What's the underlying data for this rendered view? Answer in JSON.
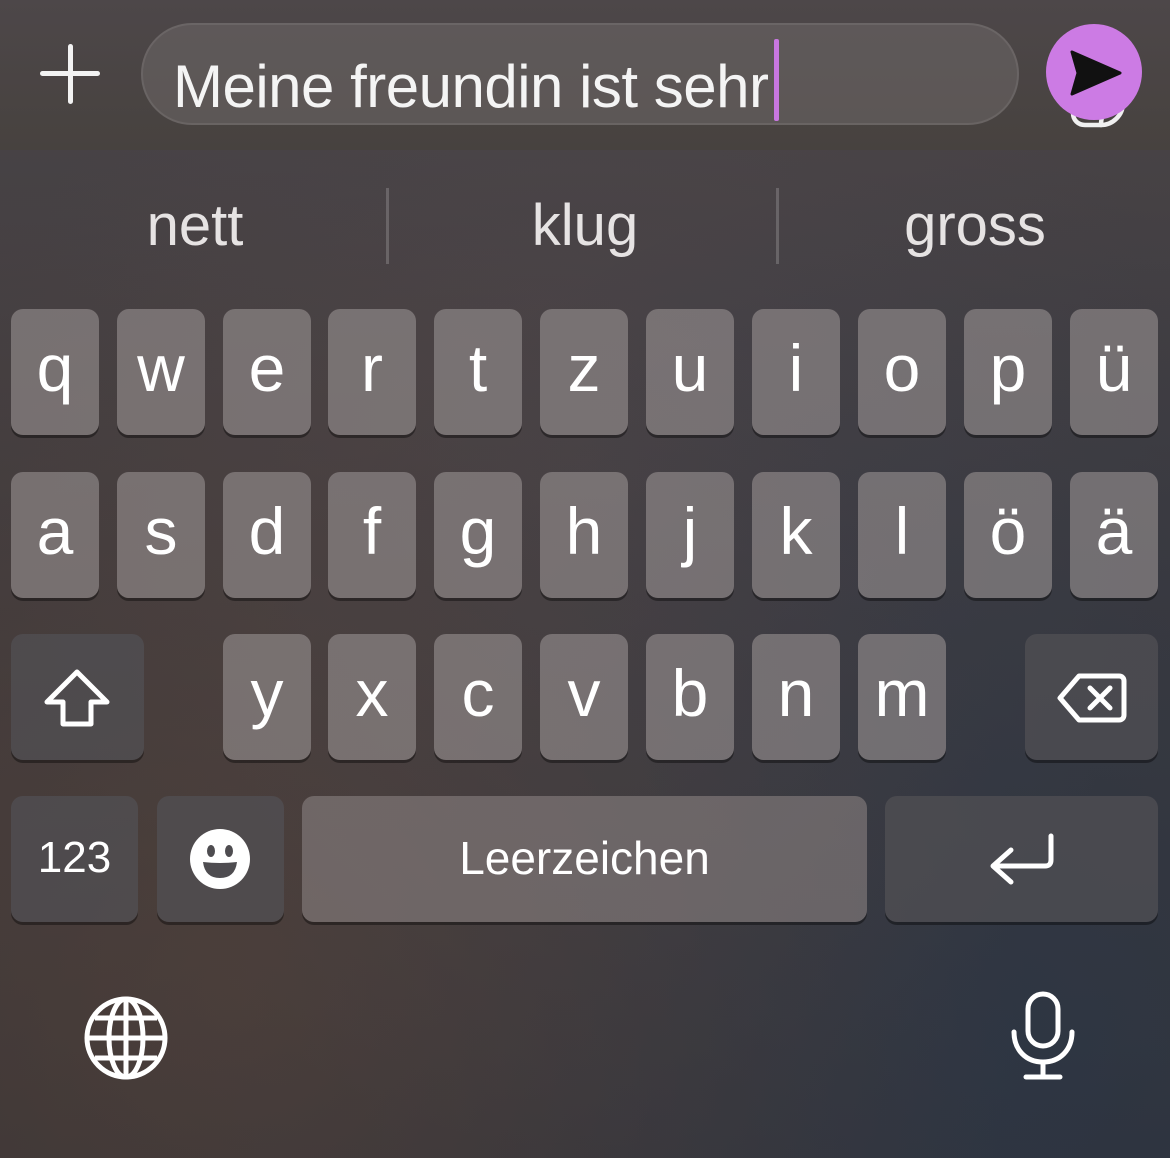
{
  "compose": {
    "text": "Meine freundin ist sehr",
    "add_icon": "plus-icon",
    "sticker_icon": "sticker-icon",
    "send_icon": "paper-plane-icon",
    "send_color": "#cc7be4",
    "caret_color": "#c877e0"
  },
  "suggestions": [
    "nett",
    "klug",
    "gross"
  ],
  "keyboard": {
    "row1": [
      "q",
      "w",
      "e",
      "r",
      "t",
      "z",
      "u",
      "i",
      "o",
      "p",
      "ü"
    ],
    "row2": [
      "a",
      "s",
      "d",
      "f",
      "g",
      "h",
      "j",
      "k",
      "l",
      "ö",
      "ä"
    ],
    "row3": [
      "y",
      "x",
      "c",
      "v",
      "b",
      "n",
      "m"
    ],
    "shift_icon": "shift-arrow-icon",
    "delete_icon": "backspace-icon",
    "numbers_label": "123",
    "emoji_icon": "emoji-smiley-icon",
    "space_label": "Leerzeichen",
    "return_icon": "return-arrow-icon",
    "globe_icon": "globe-icon",
    "mic_icon": "microphone-icon"
  }
}
